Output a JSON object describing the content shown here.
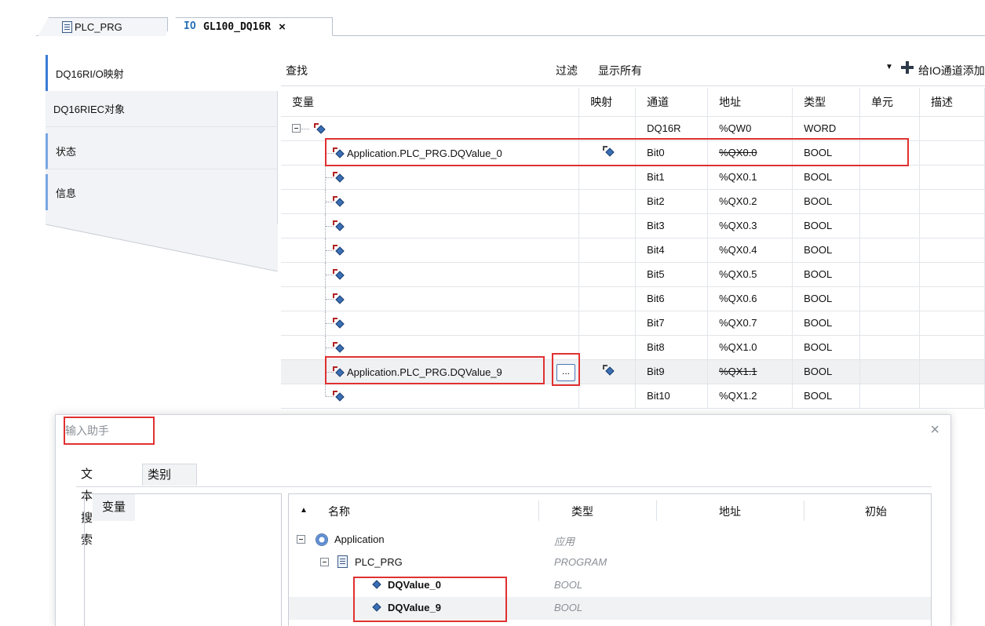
{
  "tabs": {
    "plc_prg": "PLC_PRG",
    "io_prefix": "IO",
    "io_title": "GL100_DQ16R",
    "close": "×"
  },
  "sidebar": {
    "items": [
      {
        "label": "DQ16RI/O映射"
      },
      {
        "label": "DQ16RIEC对象"
      },
      {
        "label": "状态"
      },
      {
        "label": "信息"
      }
    ]
  },
  "toolbar": {
    "find_label": "查找",
    "filter_label": "过滤",
    "filter_value": "显示所有",
    "add_label": "给IO通道添加FB"
  },
  "table": {
    "headers": {
      "variable": "变量",
      "mapping": "映射",
      "channel": "通道",
      "address": "地址",
      "type": "类型",
      "unit": "单元",
      "desc": "描述"
    },
    "parent": {
      "channel": "DQ16R",
      "address": "%QW0",
      "type": "WORD"
    },
    "rows": [
      {
        "variable": "Application.PLC_PRG.DQValue_0",
        "mapped": true,
        "channel": "Bit0",
        "address": "%QX0.0",
        "strike": true,
        "type": "BOOL"
      },
      {
        "variable": "",
        "mapped": false,
        "channel": "Bit1",
        "address": "%QX0.1",
        "strike": false,
        "type": "BOOL"
      },
      {
        "variable": "",
        "mapped": false,
        "channel": "Bit2",
        "address": "%QX0.2",
        "strike": false,
        "type": "BOOL"
      },
      {
        "variable": "",
        "mapped": false,
        "channel": "Bit3",
        "address": "%QX0.3",
        "strike": false,
        "type": "BOOL"
      },
      {
        "variable": "",
        "mapped": false,
        "channel": "Bit4",
        "address": "%QX0.4",
        "strike": false,
        "type": "BOOL"
      },
      {
        "variable": "",
        "mapped": false,
        "channel": "Bit5",
        "address": "%QX0.5",
        "strike": false,
        "type": "BOOL"
      },
      {
        "variable": "",
        "mapped": false,
        "channel": "Bit6",
        "address": "%QX0.6",
        "strike": false,
        "type": "BOOL"
      },
      {
        "variable": "",
        "mapped": false,
        "channel": "Bit7",
        "address": "%QX0.7",
        "strike": false,
        "type": "BOOL"
      },
      {
        "variable": "",
        "mapped": false,
        "channel": "Bit8",
        "address": "%QX1.0",
        "strike": false,
        "type": "BOOL"
      },
      {
        "variable": "Application.PLC_PRG.DQValue_9",
        "mapped": true,
        "channel": "Bit9",
        "address": "%QX1.1",
        "strike": true,
        "type": "BOOL"
      },
      {
        "variable": "",
        "mapped": false,
        "channel": "Bit10",
        "address": "%QX1.2",
        "strike": false,
        "type": "BOOL"
      }
    ],
    "ellipsis": "..."
  },
  "dialog": {
    "title": "输入助手",
    "close": "×",
    "tab_text_search": "文本搜索",
    "tab_category": "类别",
    "category_item": "变量",
    "columns": {
      "sort_arrow": "▲",
      "name": "名称",
      "type": "类型",
      "address": "地址",
      "initial": "初始"
    },
    "tree": [
      {
        "name": "Application",
        "type": "应用"
      },
      {
        "name": "PLC_PRG",
        "type": "PROGRAM"
      },
      {
        "name": "DQValue_0",
        "type": "BOOL"
      },
      {
        "name": "DQValue_9",
        "type": "BOOL"
      }
    ]
  },
  "colors": {
    "highlight_red": "#e03131",
    "accent_blue": "#3a7bd5"
  }
}
